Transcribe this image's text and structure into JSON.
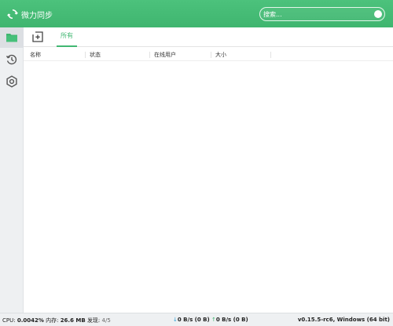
{
  "app": {
    "title": "微力同步",
    "brand_color": "#43b873"
  },
  "search": {
    "placeholder": "搜索..."
  },
  "sidebar": {
    "items": [
      {
        "icon": "folder-icon",
        "active": true
      },
      {
        "icon": "history-icon",
        "active": false
      },
      {
        "icon": "settings-icon",
        "active": false
      }
    ]
  },
  "toolbar": {
    "tabs": [
      {
        "label": "所有",
        "active": true
      }
    ]
  },
  "table": {
    "columns": [
      "名称",
      "状态",
      "在线用户",
      "大小"
    ],
    "rows": []
  },
  "statusbar": {
    "cpu_label": "CPU:",
    "cpu_value": "0.0042%",
    "memory_label": "内存:",
    "memory_value": "26.6 MB",
    "discovery_label": "发现:",
    "discovery_value": "4/5",
    "download": "0 B/s (0 B)",
    "upload": "0 B/s (0 B)",
    "version": "v0.15.5-rc6, Windows (64 bit)"
  }
}
